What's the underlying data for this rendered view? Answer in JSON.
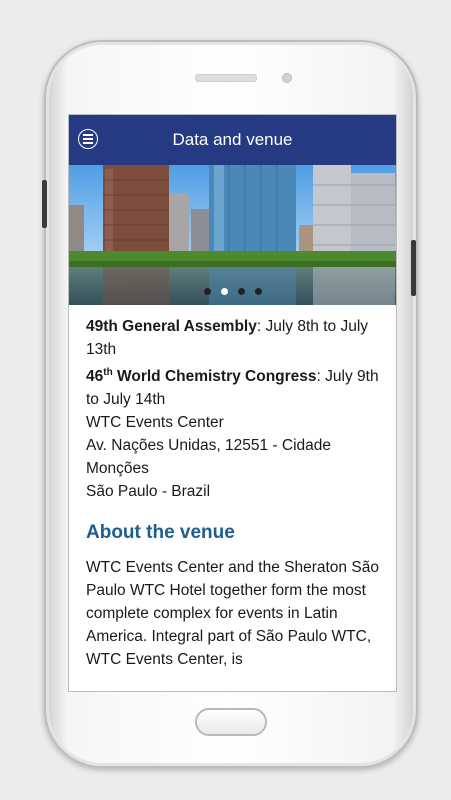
{
  "app": {
    "title": "Data and venue",
    "menu_icon": "menu-circle-icon"
  },
  "carousel": {
    "slide_count": 4,
    "active_index": 1
  },
  "info": {
    "assembly_label": "49th General Assembly",
    "assembly_dates": ": July 8th to July 13th",
    "congress_number": "46",
    "congress_sup": "th",
    "congress_label": " World Chemistry Congress",
    "congress_dates": ": July 9th to July 14th",
    "venue_name": "WTC Events Center",
    "address_line": "Av. Nações Unidas, 12551 - Cidade Monções",
    "city_line": "São Paulo - Brazil"
  },
  "about": {
    "heading": "About the venue",
    "body": "WTC Events Center and the Sheraton São Paulo WTC Hotel together form the most complete complex for events in Latin America. Integral part of São Paulo WTC, WTC Events Center, is"
  },
  "colors": {
    "appbar": "#253a82",
    "heading": "#1f5e92"
  }
}
